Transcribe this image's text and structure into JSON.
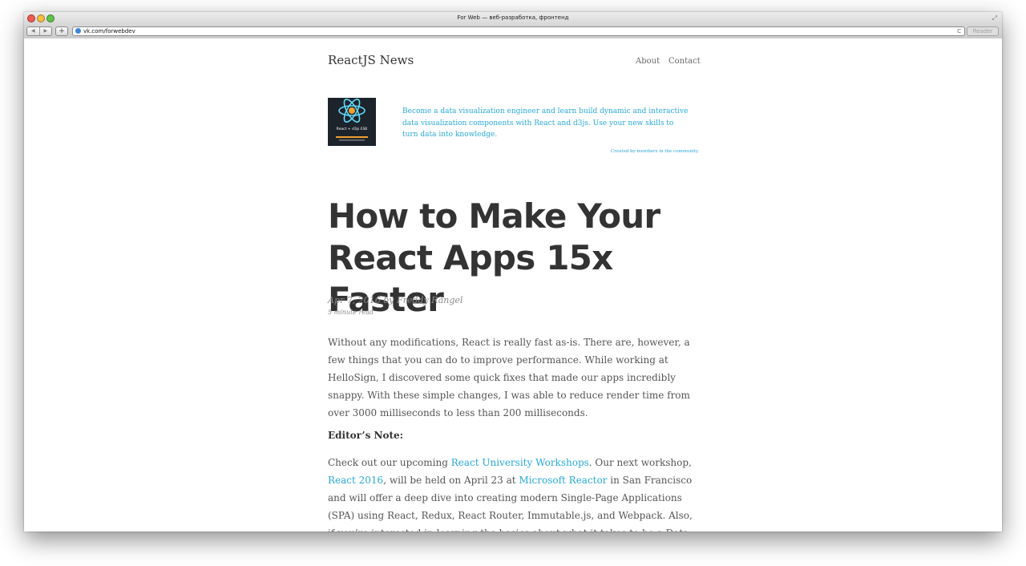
{
  "window": {
    "title": "For Web — веб-разработка, фронтенд",
    "url": "vk.com/forwebdev",
    "reader_label": "Reader",
    "back_glyph": "◀",
    "forward_glyph": "▶",
    "add_tab_glyph": "+",
    "reload_glyph": "C",
    "resize_glyph": "⤢"
  },
  "site": {
    "title": "ReactJS News",
    "nav": [
      "About",
      "Contact"
    ]
  },
  "ad": {
    "image_title": "React + d3js ES6",
    "text": "Become a data visualization engineer and learn build dynamic and interactive data visualization components with React and d3js. Use your new skills to turn data into knowledge.",
    "credit": "Created by members in the community."
  },
  "post": {
    "title": "How to Make Your React Apps 15x Faster",
    "meta": "Apr 7, 2016  by Freddy Rangel",
    "read_time": "5 minute read",
    "paragraph1": "Without any modifications, React is really fast as-is. There are, however, a few things that you can do to improve performance. While working at HelloSign, I discovered some quick fixes that made our apps incredibly snappy. With these simple changes, I was able to reduce render time from over 3000 milliseconds to less than 200 milliseconds.",
    "editors_note": "Editor’s Note:",
    "p2": {
      "t1": "Check out our upcoming ",
      "link1": "React University Workshops",
      "t2": ". Our next workshop, ",
      "link2": "React 2016",
      "t3": ", will be held on April 23 at ",
      "link3": "Microsoft Reactor",
      "t4": " in San Francisco and will offer a deep dive into creating modern Single-Page Applications (SPA) using React, Redux, React Router, Immutable.js, and Webpack. Also, if you’re interested in learning the basics about what it takes to be a Data Visualization"
    }
  },
  "colors": {
    "accent": "#29a8d8",
    "title_text": "#333333",
    "body_text": "#555555"
  }
}
